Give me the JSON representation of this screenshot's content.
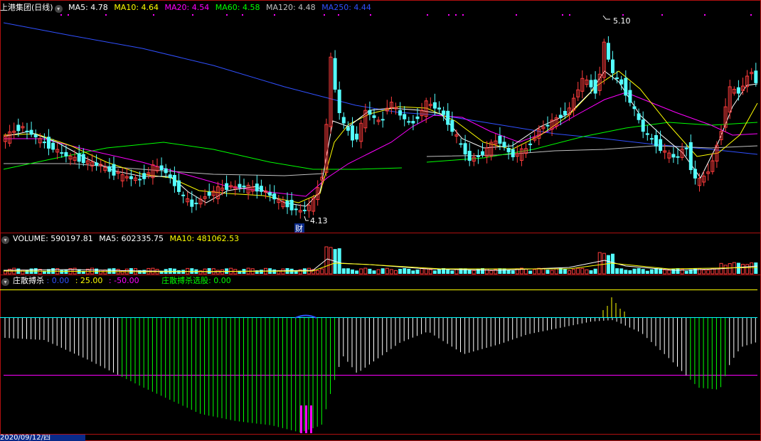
{
  "header": {
    "stock_name": "上港集团(日线)",
    "ma_labels": [
      {
        "text": "MA5: 4.78",
        "color": "#ffffff"
      },
      {
        "text": "MA10: 4.64",
        "color": "#ffff00"
      },
      {
        "text": "MA20: 4.54",
        "color": "#ff00ff"
      },
      {
        "text": "MA60: 4.58",
        "color": "#00ff00"
      },
      {
        "text": "MA120: 4.48",
        "color": "#c0c0c0"
      },
      {
        "text": "MA250: 4.44",
        "color": "#3050ff"
      }
    ]
  },
  "main_chart": {
    "high_label": "5.10",
    "low_label": "4.13",
    "event_tag": "财"
  },
  "volume_panel": {
    "labels": [
      {
        "text": "VOLUME: 590197.81",
        "color": "#ffffff"
      },
      {
        "text": "MA5: 602335.75",
        "color": "#ffffff"
      },
      {
        "text": "MA10: 481062.53",
        "color": "#ffff00"
      }
    ]
  },
  "indicator_panel": {
    "title": "庄散搏杀",
    "labels": [
      {
        "text": ": 0.00",
        "color": "#3050ff"
      },
      {
        "text": ": 25.00",
        "color": "#ffff00"
      },
      {
        "text": ": -50.00",
        "color": "#ff00ff"
      },
      {
        "text": "庄散搏杀选股: 0.00",
        "color": "#00ff00"
      }
    ]
  },
  "date_axis": {
    "current_date": "2020/09/12/四"
  },
  "colors": {
    "up": "#ff3c3c",
    "down": "#54ffff",
    "background": "#000000",
    "border": "#b01010"
  }
}
